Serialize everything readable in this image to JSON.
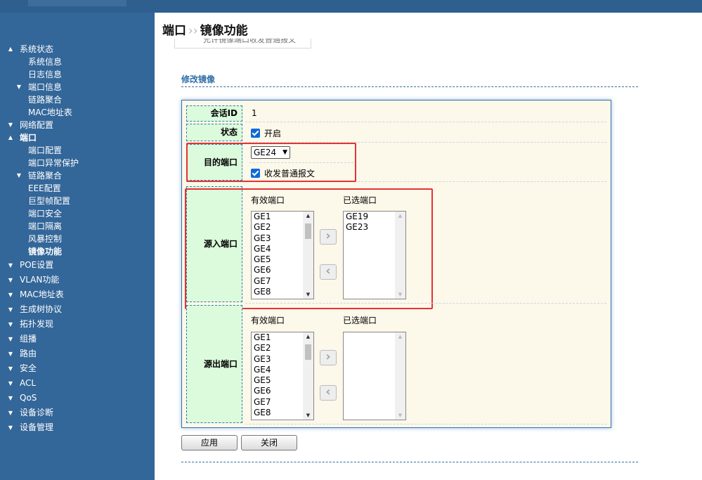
{
  "sidebar": {
    "items": [
      {
        "label": "系统状态",
        "level": 1,
        "arrow": "up"
      },
      {
        "label": "系统信息",
        "level": 2
      },
      {
        "label": "日志信息",
        "level": 2
      },
      {
        "label": "端口信息",
        "level": 2,
        "arrow": "down"
      },
      {
        "label": "链路聚合",
        "level": 2
      },
      {
        "label": "MAC地址表",
        "level": 2
      },
      {
        "label": "网络配置",
        "level": 1,
        "arrow": "down"
      },
      {
        "label": "端口",
        "level": 1,
        "arrow": "up",
        "bold": true
      },
      {
        "label": "端口配置",
        "level": 2
      },
      {
        "label": "端口异常保护",
        "level": 2
      },
      {
        "label": "链路聚合",
        "level": 2,
        "arrow": "down"
      },
      {
        "label": "EEE配置",
        "level": 2
      },
      {
        "label": "巨型帧配置",
        "level": 2
      },
      {
        "label": "端口安全",
        "level": 2
      },
      {
        "label": "端口隔离",
        "level": 2
      },
      {
        "label": "风暴控制",
        "level": 2
      },
      {
        "label": "镜像功能",
        "level": 2,
        "bold": true
      },
      {
        "label": "POE设置",
        "level": 1,
        "arrow": "down"
      },
      {
        "label": "VLAN功能",
        "level": 1,
        "arrow": "down"
      },
      {
        "label": "MAC地址表",
        "level": 1,
        "arrow": "down"
      },
      {
        "label": "生成树协议",
        "level": 1,
        "arrow": "down"
      },
      {
        "label": "拓扑发现",
        "level": 1,
        "arrow": "down"
      },
      {
        "label": "组播",
        "level": 1,
        "arrow": "down"
      },
      {
        "label": "路由",
        "level": 1,
        "arrow": "down"
      },
      {
        "label": "安全",
        "level": 1,
        "arrow": "down"
      },
      {
        "label": "ACL",
        "level": 1,
        "arrow": "down"
      },
      {
        "label": "QoS",
        "level": 1,
        "arrow": "down"
      },
      {
        "label": "设备诊断",
        "level": 1,
        "arrow": "down"
      },
      {
        "label": "设备管理",
        "level": 1,
        "arrow": "down"
      }
    ]
  },
  "page": {
    "breadcrumb_parent": "端口",
    "breadcrumb_sep": "››",
    "breadcrumb_current": "镜像功能",
    "ghost_text": "允许镜像端口收发普通报文",
    "section_title": "修改镜像"
  },
  "form": {
    "session_label": "会话ID",
    "session_value": "1",
    "status_label": "状态",
    "status_checkbox_label": "开启",
    "dest_label": "目的端口",
    "dest_port_value": "GE24",
    "dest_checkbox_label": "收发普通报文",
    "source_in_label": "源入端口",
    "source_out_label": "源出端口",
    "available_header": "有效端口",
    "selected_header": "已选端口",
    "available_ports": [
      "GE1",
      "GE2",
      "GE3",
      "GE4",
      "GE5",
      "GE6",
      "GE7",
      "GE8"
    ],
    "source_in_selected": [
      "GE19",
      "GE23"
    ],
    "source_out_selected": [],
    "add_glyph": "›",
    "remove_glyph": "‹"
  },
  "buttons": {
    "apply": "应用",
    "close": "关闭"
  },
  "colors": {
    "sidebar_bg": "#336699",
    "label_bg": "#dcfadc",
    "panel_bg": "#fcf8ea",
    "highlight": "#e53333",
    "accent": "#2f6ea7"
  }
}
